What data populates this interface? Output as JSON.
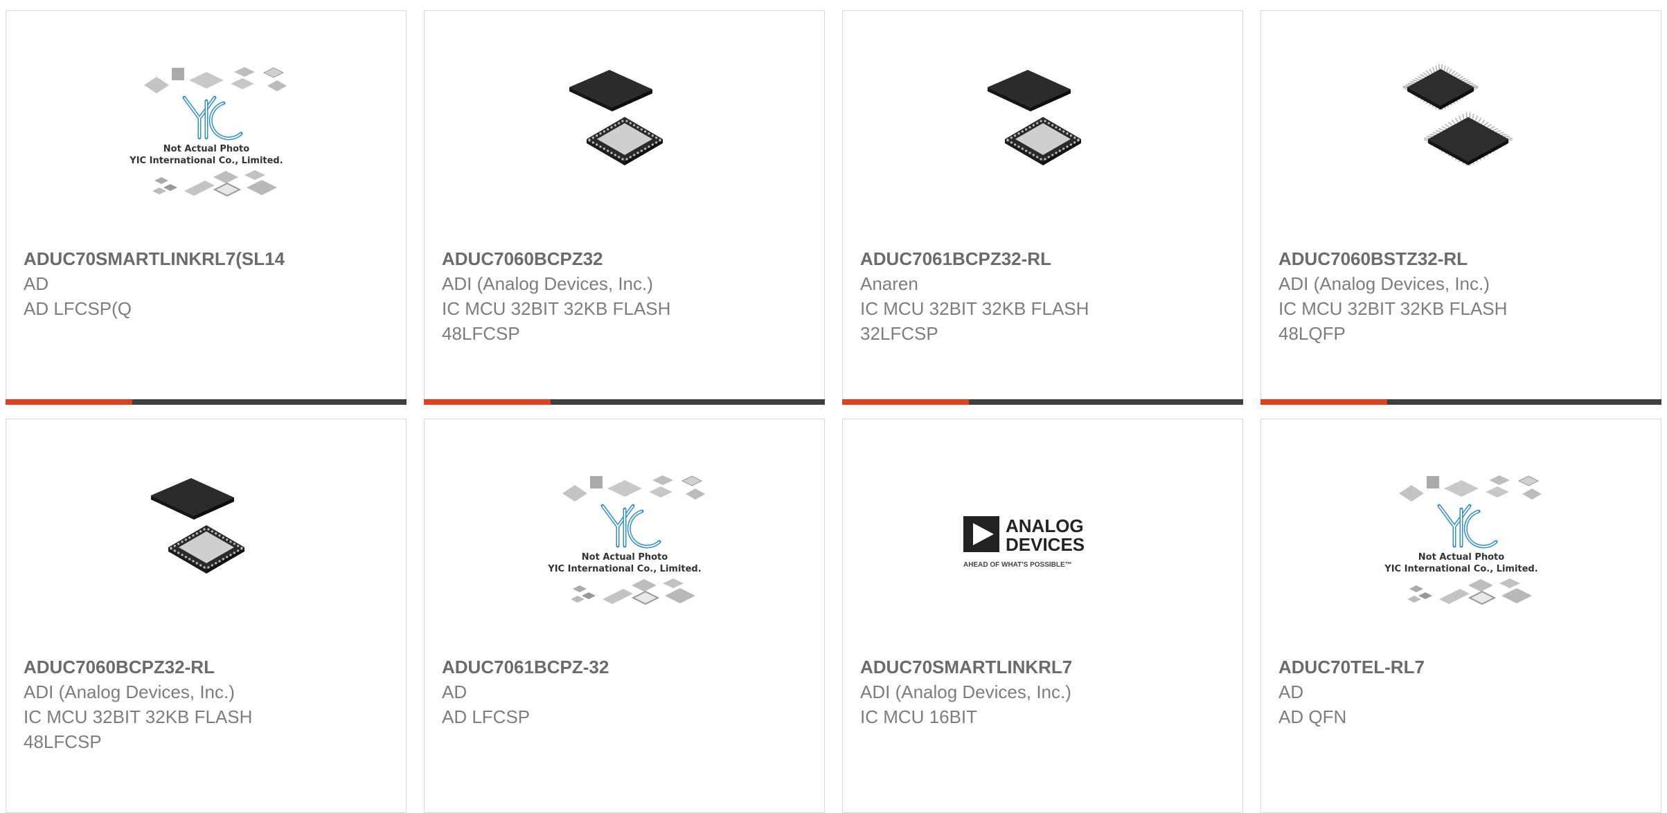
{
  "products": [
    {
      "part_number": "ADUC70SMARTLINKRL7(SL14",
      "manufacturer": "AD",
      "description": [
        "AD LFCSP(Q"
      ],
      "image": "placeholder-chips",
      "placeholder_text": [
        "Not Actual Photo",
        "YIC International Co., Limited."
      ],
      "highlighted": true
    },
    {
      "part_number": "ADUC7060BCPZ32",
      "manufacturer": "ADI (Analog Devices, Inc.)",
      "description": [
        "IC MCU 32BIT 32KB FLASH",
        "48LFCSP"
      ],
      "image": "lfcsp-chip",
      "highlighted": true
    },
    {
      "part_number": "ADUC7061BCPZ32-RL",
      "manufacturer": "Anaren",
      "description": [
        "IC MCU 32BIT 32KB FLASH",
        "32LFCSP"
      ],
      "image": "lfcsp-chip",
      "highlighted": true
    },
    {
      "part_number": "ADUC7060BSTZ32-RL",
      "manufacturer": "ADI (Analog Devices, Inc.)",
      "description": [
        "IC MCU 32BIT 32KB FLASH",
        "48LQFP"
      ],
      "image": "lqfp-chip",
      "highlighted": true
    },
    {
      "part_number": "ADUC7060BCPZ32-RL",
      "manufacturer": "ADI (Analog Devices, Inc.)",
      "description": [
        "IC MCU 32BIT 32KB FLASH",
        "48LFCSP"
      ],
      "image": "lfcsp-chip",
      "highlighted": false
    },
    {
      "part_number": "ADUC7061BCPZ-32",
      "manufacturer": "AD",
      "description": [
        "AD LFCSP"
      ],
      "image": "placeholder-chips",
      "placeholder_text": [
        "Not Actual Photo",
        "YIC International Co., Limited."
      ],
      "highlighted": false
    },
    {
      "part_number": "ADUC70SMARTLINKRL7",
      "manufacturer": "ADI (Analog Devices, Inc.)",
      "description": [
        "IC MCU 16BIT"
      ],
      "image": "analog-devices-logo",
      "logo_text": [
        "ANALOG",
        "DEVICES",
        "AHEAD OF WHAT'S POSSIBLE™"
      ],
      "highlighted": false
    },
    {
      "part_number": "ADUC70TEL-RL7",
      "manufacturer": "AD",
      "description": [
        "AD QFN"
      ],
      "image": "placeholder-chips",
      "placeholder_text": [
        "Not Actual Photo",
        "YIC International Co., Limited."
      ],
      "highlighted": false
    }
  ],
  "colors": {
    "accent": "#e0401d",
    "bar": "#3f3f3f",
    "border": "#d9d9d9",
    "title": "#6b6b6b",
    "text": "#7d7d7d",
    "yic_blue": "#2f8fd0"
  }
}
